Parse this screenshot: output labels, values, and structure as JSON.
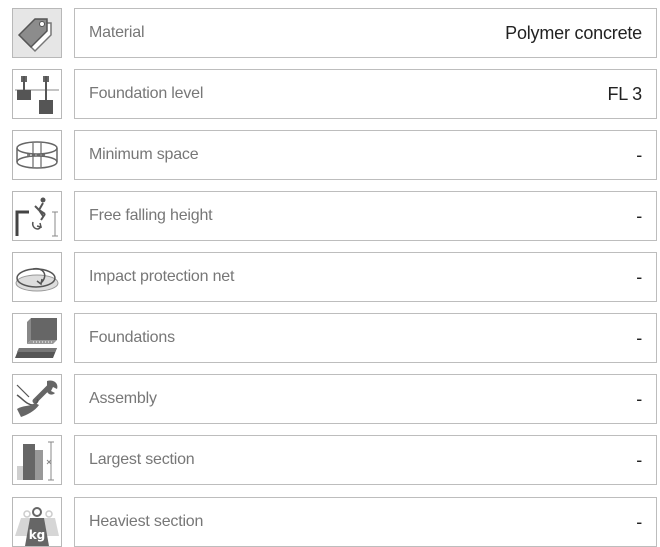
{
  "rows": [
    {
      "icon": "price-tag-icon",
      "label": "Material",
      "value": "Polymer concrete"
    },
    {
      "icon": "foundation-level-icon",
      "label": "Foundation level",
      "value": "FL 3"
    },
    {
      "icon": "minimum-space-icon",
      "label": "Minimum space",
      "value": "-"
    },
    {
      "icon": "free-fall-icon",
      "label": "Free falling height",
      "value": "-"
    },
    {
      "icon": "impact-net-icon",
      "label": "Impact protection net",
      "value": "-"
    },
    {
      "icon": "foundation-block-icon",
      "label": "Foundations",
      "value": "-"
    },
    {
      "icon": "wrench-hand-icon",
      "label": "Assembly",
      "value": "-"
    },
    {
      "icon": "section-size-icon",
      "label": "Largest section",
      "value": "-"
    },
    {
      "icon": "weight-kg-icon",
      "label": "Heaviest section",
      "value": "-",
      "icon_text": "kg"
    }
  ]
}
